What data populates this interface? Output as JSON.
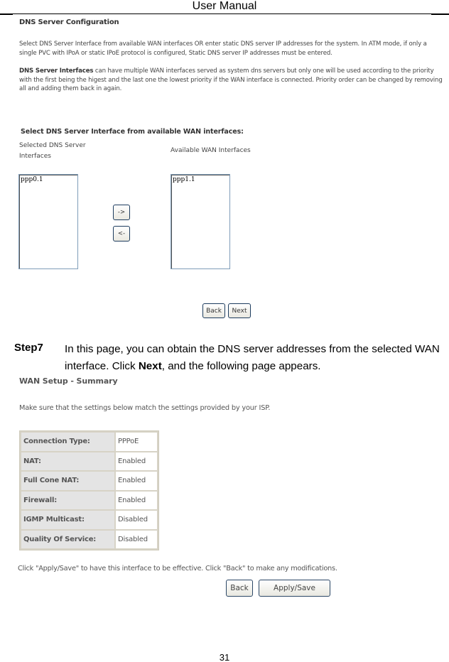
{
  "header": {
    "title": "User Manual"
  },
  "dns_config": {
    "title": "DNS Server Configuration",
    "paragraph1": "Select DNS Server Interface from available WAN interfaces OR enter static DNS server IP addresses for the system. In ATM mode, if only a single PVC with IPoA or static IPoE protocol is configured, Static DNS server IP addresses must be entered.",
    "paragraph2_bold": "DNS Server Interfaces",
    "paragraph2_rest": " can have multiple WAN interfaces served as system dns servers but only one will be used according to the priority with the first being the higest and the last one the lowest priority if the WAN interface is connected. Priority order can be changed by removing all and adding them back in again.",
    "select_heading": "Select DNS Server Interface from available WAN interfaces:",
    "selected_label": "Selected DNS Server Interfaces",
    "available_label": "Available WAN Interfaces",
    "selected_items": [
      "ppp0.1"
    ],
    "available_items": [
      "ppp1.1"
    ],
    "add_button": "->",
    "remove_button": "<-",
    "back_button": "Back",
    "next_button": "Next"
  },
  "step": {
    "label": "Step7",
    "text_before": "In this page, you can obtain the DNS server addresses from the selected WAN interface. Click ",
    "text_bold": "Next",
    "text_after": ", and the following page appears."
  },
  "wan_summary": {
    "title": "WAN Setup - Summary",
    "description": "Make sure that the settings below match the settings provided by your ISP.",
    "rows": [
      {
        "key": "Connection Type:",
        "value": "PPPoE"
      },
      {
        "key": "NAT:",
        "value": "Enabled"
      },
      {
        "key": "Full Cone NAT:",
        "value": "Enabled"
      },
      {
        "key": "Firewall:",
        "value": "Enabled"
      },
      {
        "key": "IGMP Multicast:",
        "value": "Disabled"
      },
      {
        "key": "Quality Of Service:",
        "value": "Disabled"
      }
    ],
    "note": "Click \"Apply/Save\" to have this interface to be effective. Click \"Back\" to make any modifications.",
    "back_button": "Back",
    "apply_button": "Apply/Save"
  },
  "footer": {
    "page_number": "31"
  }
}
